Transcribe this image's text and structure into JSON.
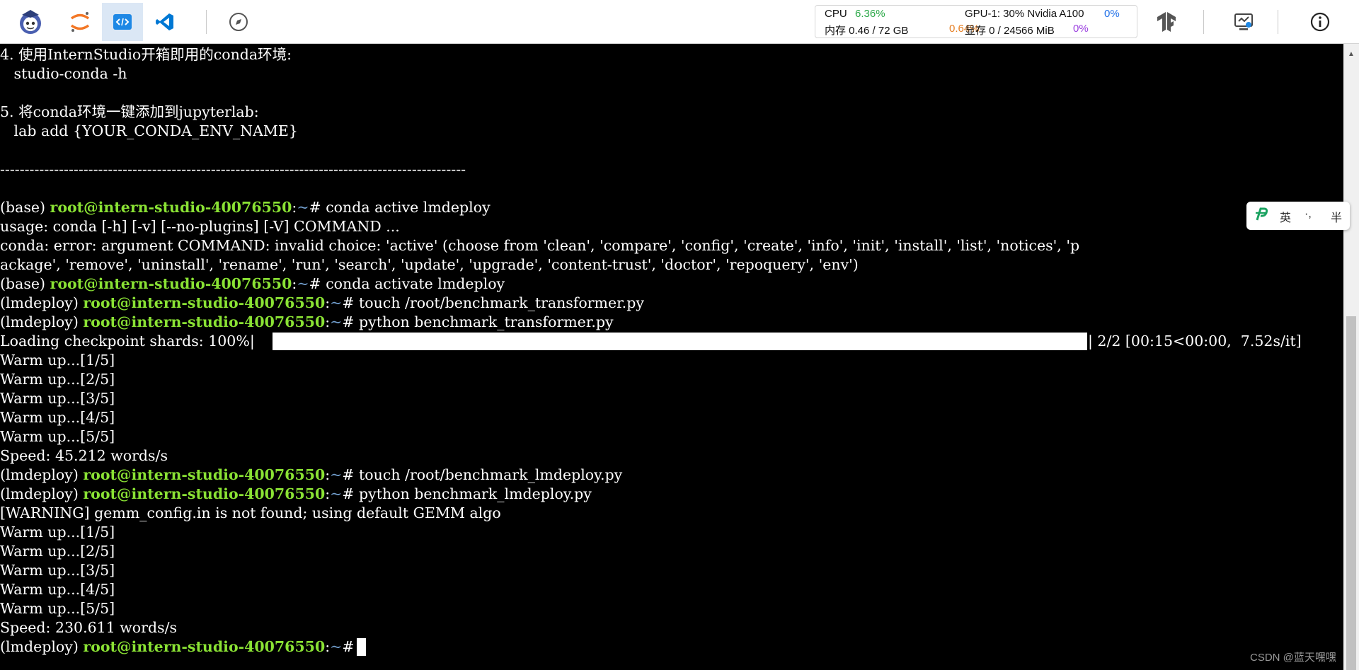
{
  "toolbar": {
    "icons": [
      {
        "name": "intern-logo-icon"
      },
      {
        "name": "jupyter-icon"
      },
      {
        "name": "code-editor-icon",
        "active": true
      },
      {
        "name": "vscode-icon"
      },
      {
        "name": "compass-icon"
      }
    ],
    "right_icons": [
      "tensorboard-icon",
      "remote-desktop-icon",
      "info-icon"
    ]
  },
  "monitor": {
    "cpu_label": "CPU",
    "cpu_value": "6.36%",
    "mem_label": "内存 0.46 / 72 GB",
    "mem_value": "0.64%",
    "gpu_label": "GPU-1: 30% Nvidia A100",
    "gpu_value": "0%",
    "vram_label": "显存 0 / 24566 MiB",
    "vram_value": "0%"
  },
  "terminal": {
    "lines": [
      {
        "text": "4. 使用InternStudio开箱即用的conda环境:"
      },
      {
        "text": "   studio-conda -h"
      },
      {
        "text": ""
      },
      {
        "text": "5. 将conda环境一键添加到jupyterlab:"
      },
      {
        "text": "   lab add {YOUR_CONDA_ENV_NAME}"
      },
      {
        "text": ""
      },
      {
        "text": "-----------------------------------------------------------------------------------------------"
      },
      {
        "text": ""
      },
      {
        "prefix": "(base) ",
        "user": "root@intern-studio-40076550",
        "colon": ":",
        "tilde": "~",
        "cmd": "# conda active lmdeploy"
      },
      {
        "text": "usage: conda [-h] [-v] [--no-plugins] [-V] COMMAND ..."
      },
      {
        "text": "conda: error: argument COMMAND: invalid choice: 'active' (choose from 'clean', 'compare', 'config', 'create', 'info', 'init', 'install', 'list', 'notices', 'p"
      },
      {
        "text": "ackage', 'remove', 'uninstall', 'rename', 'run', 'search', 'update', 'upgrade', 'content-trust', 'doctor', 'repoquery', 'env')"
      },
      {
        "prefix": "(base) ",
        "user": "root@intern-studio-40076550",
        "colon": ":",
        "tilde": "~",
        "cmd": "# conda activate lmdeploy"
      },
      {
        "prefix": "(lmdeploy) ",
        "user": "root@intern-studio-40076550",
        "colon": ":",
        "tilde": "~",
        "cmd": "# touch /root/benchmark_transformer.py"
      },
      {
        "prefix": "(lmdeploy) ",
        "user": "root@intern-studio-40076550",
        "colon": ":",
        "tilde": "~",
        "cmd": "# python benchmark_transformer.py"
      },
      {
        "text": "Loading checkpoint shards: 100%|",
        "tail": "| 2/2 [00:15<00:00,  7.52s/it]",
        "progress": 1.0
      },
      {
        "text": "Warm up...[1/5]"
      },
      {
        "text": "Warm up...[2/5]"
      },
      {
        "text": "Warm up...[3/5]"
      },
      {
        "text": "Warm up...[4/5]"
      },
      {
        "text": "Warm up...[5/5]"
      },
      {
        "text": "Speed: 45.212 words/s"
      },
      {
        "prefix": "(lmdeploy) ",
        "user": "root@intern-studio-40076550",
        "colon": ":",
        "tilde": "~",
        "cmd": "# touch /root/benchmark_lmdeploy.py"
      },
      {
        "prefix": "(lmdeploy) ",
        "user": "root@intern-studio-40076550",
        "colon": ":",
        "tilde": "~",
        "cmd": "# python benchmark_lmdeploy.py"
      },
      {
        "text": "[WARNING] gemm_config.in is not found; using default GEMM algo"
      },
      {
        "text": "Warm up...[1/5]"
      },
      {
        "text": "Warm up...[2/5]"
      },
      {
        "text": "Warm up...[3/5]"
      },
      {
        "text": "Warm up...[4/5]"
      },
      {
        "text": "Warm up...[5/5]"
      },
      {
        "text": "Speed: 230.611 words/s"
      },
      {
        "prefix": "(lmdeploy) ",
        "user": "root@intern-studio-40076550",
        "colon": ":",
        "tilde": "~",
        "cmd": "# "
      }
    ]
  },
  "ime": {
    "mode": "英",
    "punct": "·,",
    "width": "半"
  },
  "watermark": "CSDN @蓝天嘿嘿"
}
